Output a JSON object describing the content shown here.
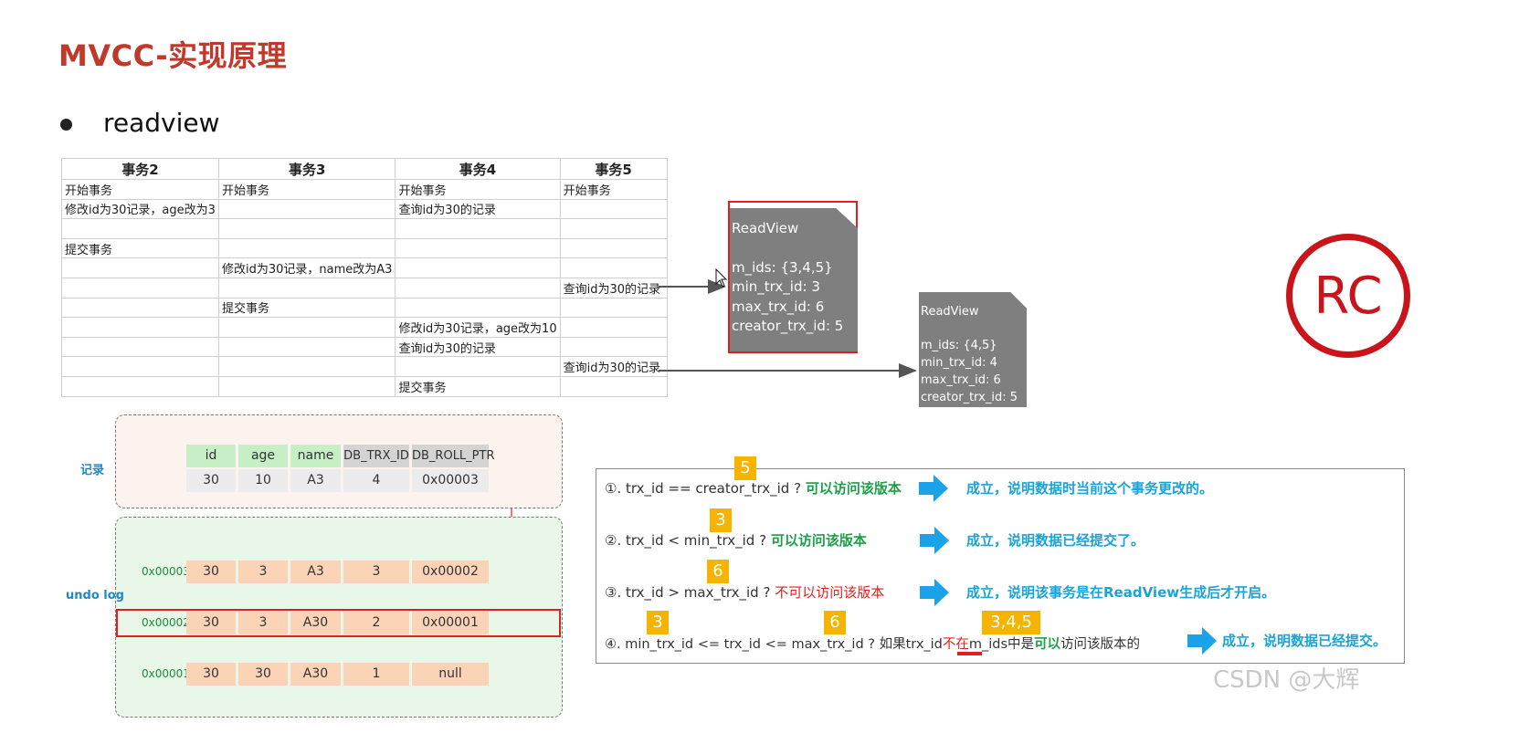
{
  "slide": {
    "title": "MVCC-实现原理",
    "bullet": "readview"
  },
  "tx_table": {
    "headers": [
      "事务2",
      "事务3",
      "事务4",
      "事务5"
    ],
    "rows": [
      [
        "开始事务",
        "开始事务",
        "开始事务",
        "开始事务"
      ],
      [
        "修改id为30记录，age改为3",
        "",
        "查询id为30的记录",
        ""
      ],
      [
        "",
        "",
        "",
        ""
      ],
      [
        "提交事务",
        "",
        "",
        ""
      ],
      [
        "",
        "修改id为30记录，name改为A3",
        "",
        ""
      ],
      [
        "",
        "",
        "",
        "查询id为30的记录"
      ],
      [
        "",
        "提交事务",
        "",
        ""
      ],
      [
        "",
        "",
        "修改id为30记录，age改为10",
        ""
      ],
      [
        "",
        "",
        "查询id为30的记录",
        ""
      ],
      [
        "",
        "",
        "",
        "查询id为30的记录"
      ],
      [
        "",
        "",
        "提交事务",
        ""
      ]
    ]
  },
  "readview1": {
    "title": "ReadView",
    "m_ids": "m_ids: {3,4,5}",
    "min": "min_trx_id: 3",
    "max": "max_trx_id: 6",
    "creator": "creator_trx_id: 5"
  },
  "readview2": {
    "title": "ReadView",
    "m_ids": "m_ids: {4,5}",
    "min": "min_trx_id: 4",
    "max": "max_trx_id: 6",
    "creator": "creator_trx_id: 5"
  },
  "badge_rc": "RC",
  "record": {
    "label": "记录",
    "headers": [
      "id",
      "age",
      "name",
      "DB_TRX_ID",
      "DB_ROLL_PTR"
    ],
    "values": [
      "30",
      "10",
      "A3",
      "4",
      "0x00003"
    ]
  },
  "undo_log": {
    "label": "undo log",
    "rows": [
      {
        "addr": "0x00003",
        "values": [
          "30",
          "3",
          "A3",
          "3",
          "0x00002"
        ]
      },
      {
        "addr": "0x00002",
        "values": [
          "30",
          "3",
          "A30",
          "2",
          "0x00001"
        ]
      },
      {
        "addr": "0x00001",
        "values": [
          "30",
          "30",
          "A30",
          "1",
          "null"
        ]
      }
    ]
  },
  "rules": [
    {
      "text": "①. trx_id  == creator_trx_id ?",
      "allow": "可以访问该版本",
      "result": "成立，说明数据时当前这个事务更改的。"
    },
    {
      "text": "②. trx_id < min_trx_id ?",
      "allow": "可以访问该版本",
      "result": "成立，说明数据已经提交了。"
    },
    {
      "text": "③. trx_id > max_trx_id ?",
      "deny": "不可以访问该版本",
      "result": "成立，说明该事务是在ReadView生成后才开启。"
    },
    {
      "text": "④. min_trx_id <= trx_id <= max_trx_id ?  如果trx_id",
      "emph": "不在",
      "text2": "m_ids中是",
      "allow": "可以",
      "text3": "访问该版本的",
      "result": "成立，说明数据已经提交。"
    }
  ],
  "badges": [
    "5",
    "3",
    "6",
    "3",
    "6",
    "3,4,5"
  ],
  "colors": {
    "title": "#c0392b",
    "accent_red": "#e02020",
    "green": "#1e9e4a",
    "blue": "#1aa3d9",
    "badge": "#f6b400"
  },
  "watermark": "CSDN @大辉"
}
